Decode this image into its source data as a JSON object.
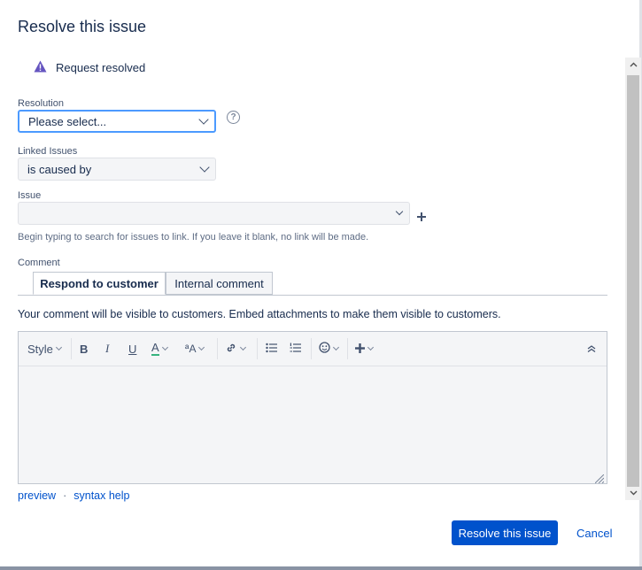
{
  "dialog": {
    "title": "Resolve this issue",
    "status_text": "Request resolved"
  },
  "resolution": {
    "label": "Resolution",
    "value": "Please select..."
  },
  "linked_issues": {
    "label": "Linked Issues",
    "value": "is caused by"
  },
  "issue": {
    "label": "Issue",
    "value": "",
    "hint": "Begin typing to search for issues to link. If you leave it blank, no link will be made."
  },
  "comment": {
    "label": "Comment",
    "tabs": [
      "Respond to customer",
      "Internal comment"
    ],
    "visibility_note": "Your comment will be visible to customers. Embed attachments to make them visible to customers.",
    "toolbar": {
      "style": "Style",
      "bold": "B",
      "italic": "I",
      "underline": "U",
      "text_color": "A",
      "text_size": "ªA"
    },
    "links": {
      "preview": "preview",
      "separator": "·",
      "syntax_help": "syntax help"
    }
  },
  "actions": {
    "submit": "Resolve this issue",
    "cancel": "Cancel"
  },
  "colors": {
    "accent": "#0052cc",
    "warning_icon": "#6554c0",
    "text_color_underline": "#36b37e"
  },
  "icons": [
    "warning-icon",
    "help-icon",
    "chevron-down-icon",
    "plus-icon",
    "link-icon",
    "bullet-list-icon",
    "numbered-list-icon",
    "emoji-icon",
    "insert-more-icon",
    "collapse-toolbar-icon",
    "resize-handle-icon"
  ]
}
